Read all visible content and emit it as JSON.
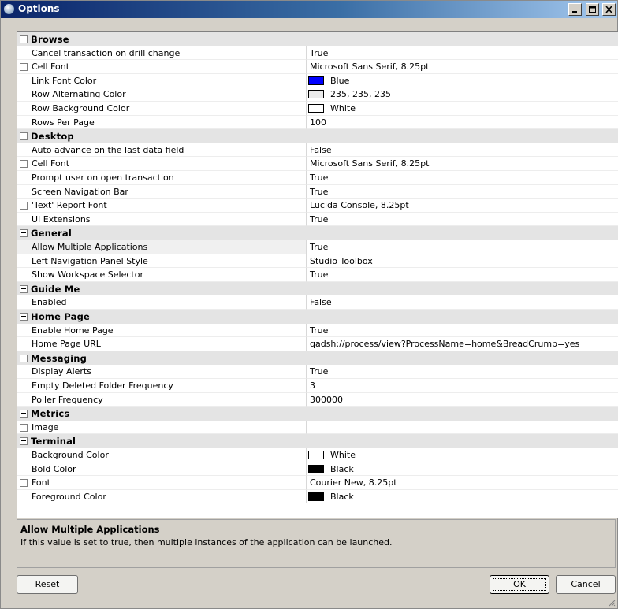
{
  "window": {
    "title": "Options"
  },
  "categories": [
    {
      "label": "Browse",
      "props": [
        {
          "name": "Cancel transaction on drill change",
          "value": "True",
          "expandable": false
        },
        {
          "name": "Cell Font",
          "value": "Microsoft Sans Serif, 8.25pt",
          "expandable": true
        },
        {
          "name": "Link Font Color",
          "value": "Blue",
          "swatch": "#0000ff",
          "expandable": false
        },
        {
          "name": "Row Alternating Color",
          "value": "235, 235, 235",
          "swatch": "#ebebeb",
          "expandable": false
        },
        {
          "name": "Row Background Color",
          "value": "White",
          "swatch": "#ffffff",
          "expandable": false
        },
        {
          "name": "Rows Per Page",
          "value": "100",
          "expandable": false
        }
      ]
    },
    {
      "label": "Desktop",
      "props": [
        {
          "name": "Auto advance on the last data field",
          "value": "False",
          "expandable": false
        },
        {
          "name": "Cell Font",
          "value": "Microsoft Sans Serif, 8.25pt",
          "expandable": true
        },
        {
          "name": "Prompt user on open transaction",
          "value": "True",
          "expandable": false
        },
        {
          "name": "Screen Navigation Bar",
          "value": "True",
          "expandable": false
        },
        {
          "name": "'Text' Report Font",
          "value": "Lucida Console, 8.25pt",
          "expandable": true
        },
        {
          "name": "UI Extensions",
          "value": "True",
          "expandable": false
        }
      ]
    },
    {
      "label": "General",
      "props": [
        {
          "name": "Allow Multiple Applications",
          "value": "True",
          "expandable": false,
          "selected": true
        },
        {
          "name": "Left Navigation Panel Style",
          "value": "Studio Toolbox",
          "expandable": false
        },
        {
          "name": "Show Workspace Selector",
          "value": "True",
          "expandable": false
        }
      ]
    },
    {
      "label": "Guide Me",
      "props": [
        {
          "name": "Enabled",
          "value": "False",
          "expandable": false
        }
      ]
    },
    {
      "label": "Home Page",
      "props": [
        {
          "name": "Enable Home Page",
          "value": "True",
          "expandable": false
        },
        {
          "name": "Home Page URL",
          "value": "qadsh://process/view?ProcessName=home&BreadCrumb=yes",
          "expandable": false
        }
      ]
    },
    {
      "label": "Messaging",
      "props": [
        {
          "name": "Display Alerts",
          "value": "True",
          "expandable": false
        },
        {
          "name": "Empty Deleted Folder Frequency",
          "value": "3",
          "expandable": false
        },
        {
          "name": "Poller Frequency",
          "value": "300000",
          "expandable": false
        }
      ]
    },
    {
      "label": "Metrics",
      "props": [
        {
          "name": "Image",
          "value": "",
          "expandable": true
        }
      ]
    },
    {
      "label": "Terminal",
      "props": [
        {
          "name": "Background Color",
          "value": "White",
          "swatch": "#ffffff",
          "expandable": false
        },
        {
          "name": "Bold Color",
          "value": "Black",
          "swatch": "#000000",
          "expandable": false
        },
        {
          "name": "Font",
          "value": "Courier New, 8.25pt",
          "expandable": true
        },
        {
          "name": "Foreground Color",
          "value": "Black",
          "swatch": "#000000",
          "expandable": false
        }
      ]
    }
  ],
  "help": {
    "title": "Allow Multiple Applications",
    "description": "If this value is set to true, then multiple instances of the application can be launched."
  },
  "buttons": {
    "reset": "Reset",
    "ok": "OK",
    "cancel": "Cancel"
  },
  "colors": {
    "titlebar": "#0a246a",
    "category_bg": "#e4e4e4",
    "window_bg": "#d4d0c8"
  }
}
